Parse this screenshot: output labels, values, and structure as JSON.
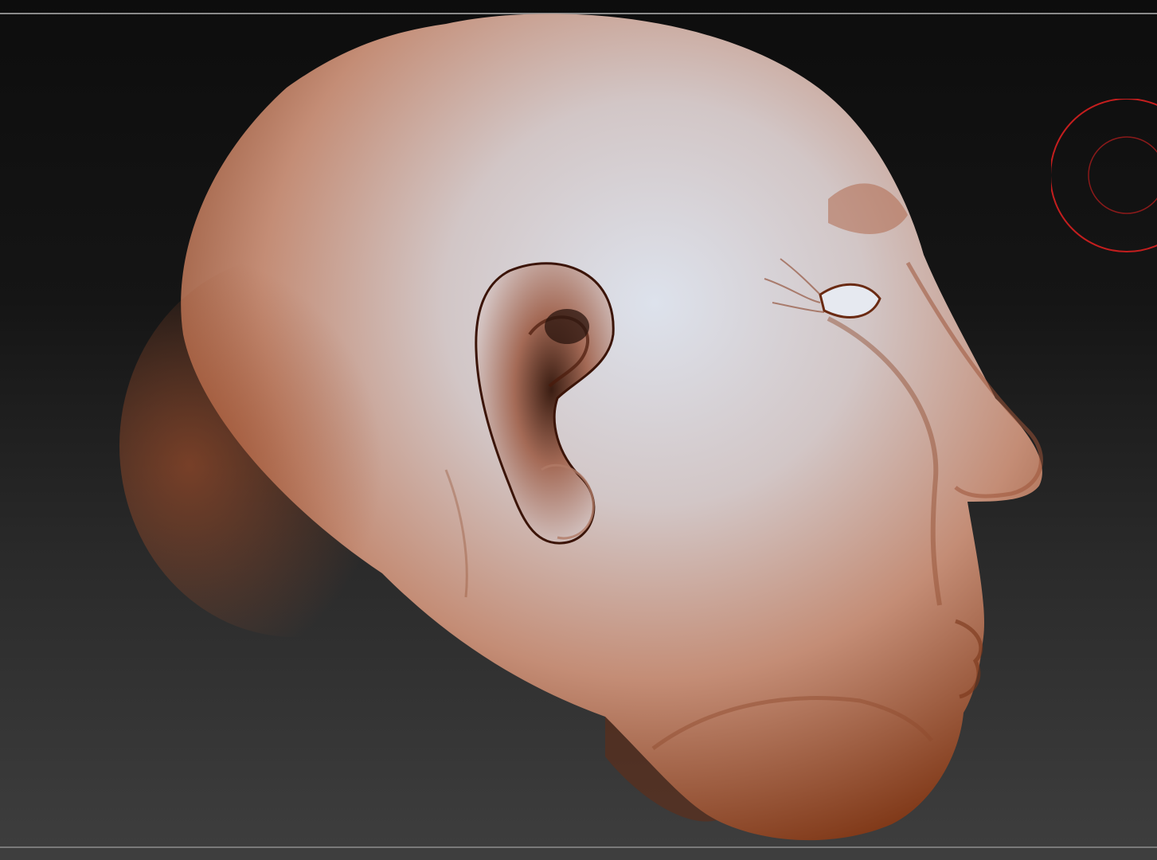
{
  "viewport": {
    "background_top": "#0d0d0d",
    "background_bottom": "#3e3e3e",
    "separator_color": "#8a8a8a"
  },
  "model": {
    "skin_light": "#d9dde6",
    "skin_mid": "#c79a86",
    "skin_dark": "#8a3f22",
    "crease": "#5a1a08"
  },
  "brush_cursor": {
    "color": "#c41e1e",
    "icon": "brush-cursor-icon"
  }
}
